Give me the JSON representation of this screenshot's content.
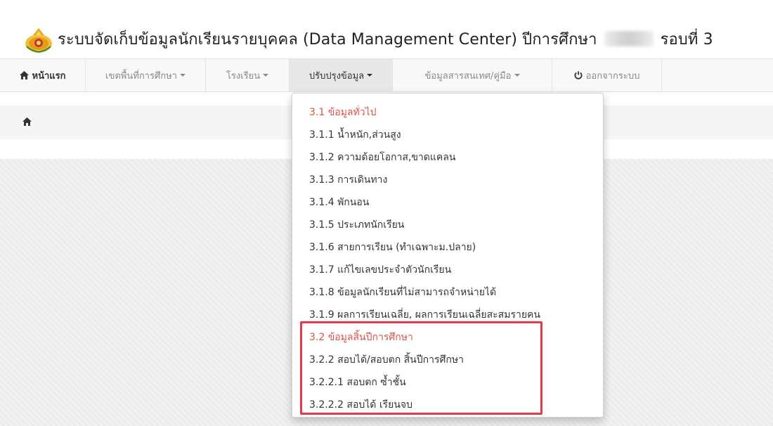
{
  "header": {
    "title_main": "ระบบจัดเก็บข้อมูลนักเรียนรายบุคคล (Data Management Center) ปีการศึกษา",
    "title_round": "รอบที่ 3"
  },
  "navbar": {
    "items": [
      {
        "label": "หน้าแรก",
        "icon": "home-icon"
      },
      {
        "label": "เขตพื้นที่การศึกษา"
      },
      {
        "label": "โรงเรียน"
      },
      {
        "label": "ปรับปรุงข้อมูล"
      },
      {
        "label": "ข้อมูลสารสนเทศ/คู่มือ"
      },
      {
        "label": "ออกจากระบบ",
        "icon": "power-icon"
      }
    ]
  },
  "breadcrumb": {
    "icon": "home-icon"
  },
  "dropdown": {
    "items": [
      {
        "label": "3.1 ข้อมูลทั่วไป",
        "type": "header"
      },
      {
        "label": "3.1.1 น้ำหนัก,ส่วนสูง"
      },
      {
        "label": "3.1.2 ความด้อยโอกาส,ขาดแคลน"
      },
      {
        "label": "3.1.3 การเดินทาง"
      },
      {
        "label": "3.1.4 พักนอน"
      },
      {
        "label": "3.1.5 ประเภทนักเรียน"
      },
      {
        "label": "3.1.6 สายการเรียน (ทำเฉพาะม.ปลาย)"
      },
      {
        "label": "3.1.7 แก้ไขเลขประจำตัวนักเรียน"
      },
      {
        "label": "3.1.8 ข้อมูลนักเรียนที่ไม่สามารถจำหน่ายได้"
      },
      {
        "label": "3.1.9 ผลการเรียนเฉลี่ย, ผลการเรียนเฉลี่ยสะสมรายคน"
      },
      {
        "label": "3.2 ข้อมูลสิ้นปีการศึกษา",
        "type": "header"
      },
      {
        "label": "3.2.2 สอบได้/สอบตก สิ้นปีการศึกษา"
      },
      {
        "label": "3.2.2.1 สอบตก ซ้ำชั้น"
      },
      {
        "label": "3.2.2.2 สอบได้ เรียนจบ"
      }
    ]
  },
  "colors": {
    "section_header": "#d9534f",
    "highlight_border": "#e23b45",
    "navbar_bg": "#f8f8f8",
    "active_nav_bg": "#e7e7e7"
  }
}
